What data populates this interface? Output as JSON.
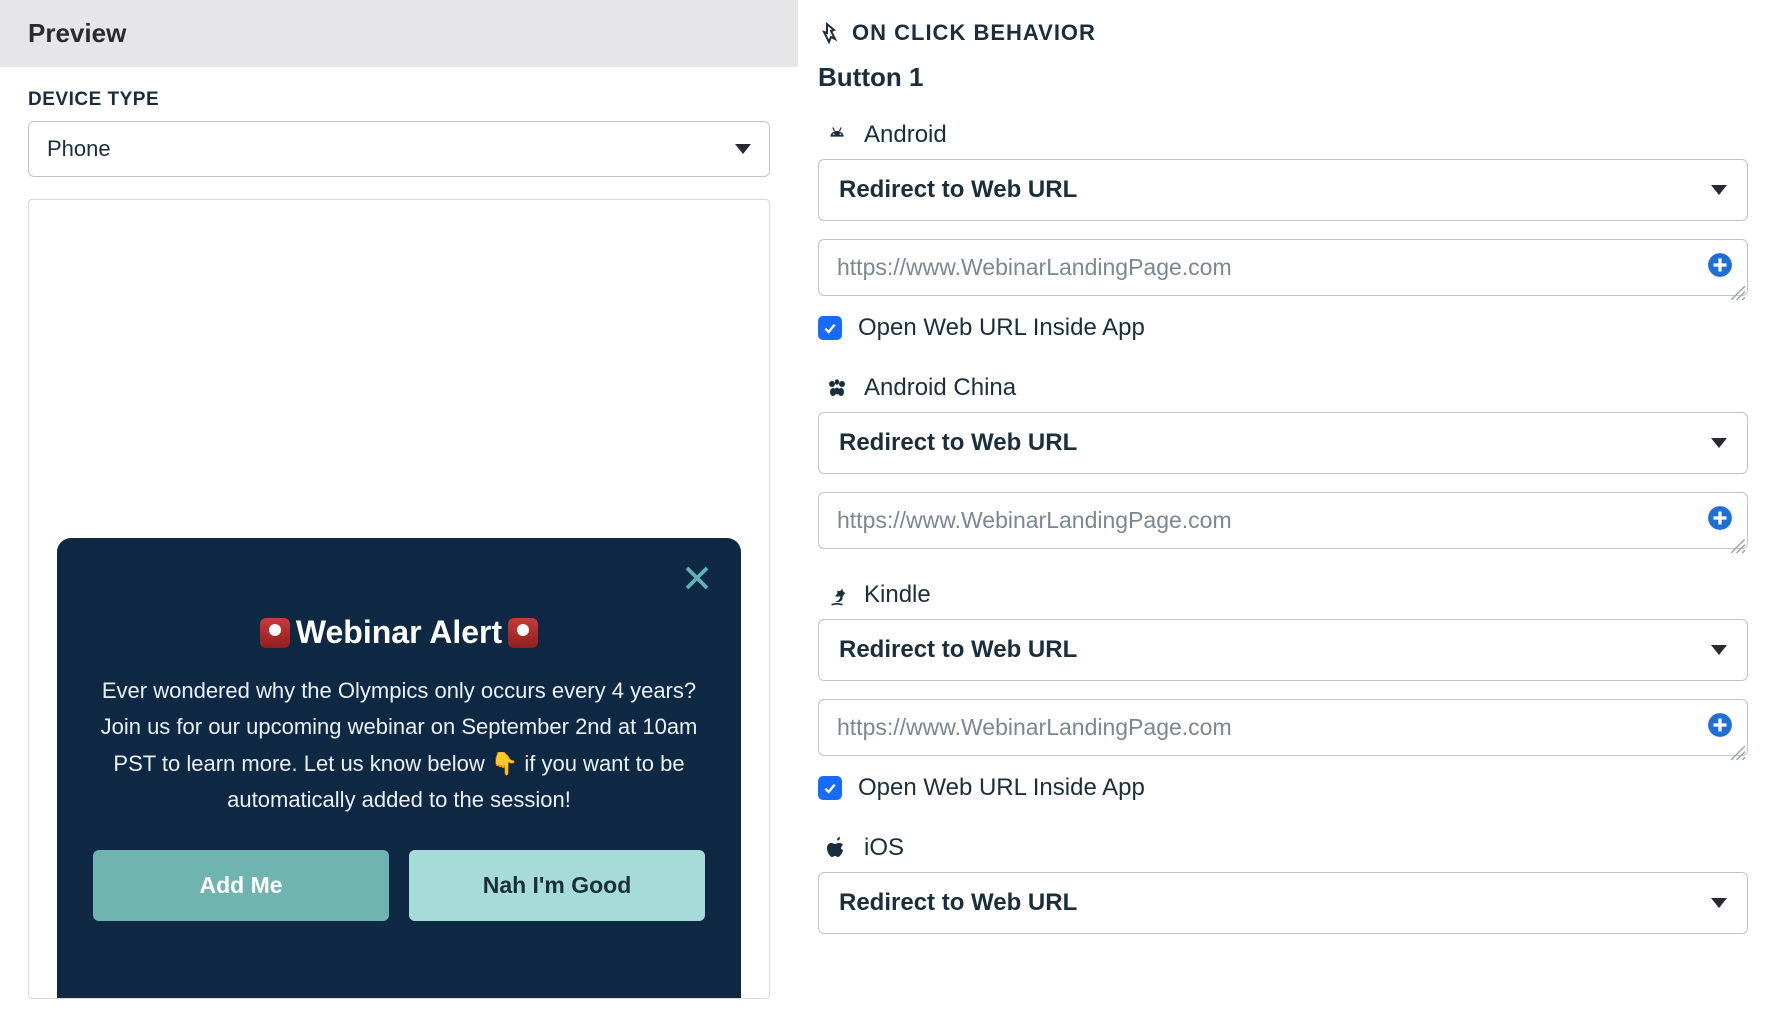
{
  "preview": {
    "header": "Preview",
    "device_type_label": "DEVICE TYPE",
    "device_type_value": "Phone",
    "modal": {
      "title": "Webinar Alert",
      "body": "Ever wondered why the Olympics only occurs every 4 years? Join us for our upcoming webinar on September 2nd at 10am PST to learn more. Let us know below 👇 if you want to be automatically added to the session!",
      "primary_button": "Add Me",
      "secondary_button": "Nah I'm Good"
    }
  },
  "onclick": {
    "section_title": "ON CLICK BEHAVIOR",
    "button_label": "Button 1",
    "platforms": [
      {
        "key": "android",
        "label": "Android",
        "action": "Redirect to Web URL",
        "url": "https://www.WebinarLandingPage.com",
        "open_inside_label": "Open Web URL Inside App",
        "open_inside": true,
        "show_checkbox": true
      },
      {
        "key": "android-china",
        "label": "Android China",
        "action": "Redirect to Web URL",
        "url": "https://www.WebinarLandingPage.com",
        "show_checkbox": false
      },
      {
        "key": "kindle",
        "label": "Kindle",
        "action": "Redirect to Web URL",
        "url": "https://www.WebinarLandingPage.com",
        "open_inside_label": "Open Web URL Inside App",
        "open_inside": true,
        "show_checkbox": true
      },
      {
        "key": "ios",
        "label": "iOS",
        "action": "Redirect to Web URL",
        "show_url": false,
        "show_checkbox": false
      }
    ]
  }
}
